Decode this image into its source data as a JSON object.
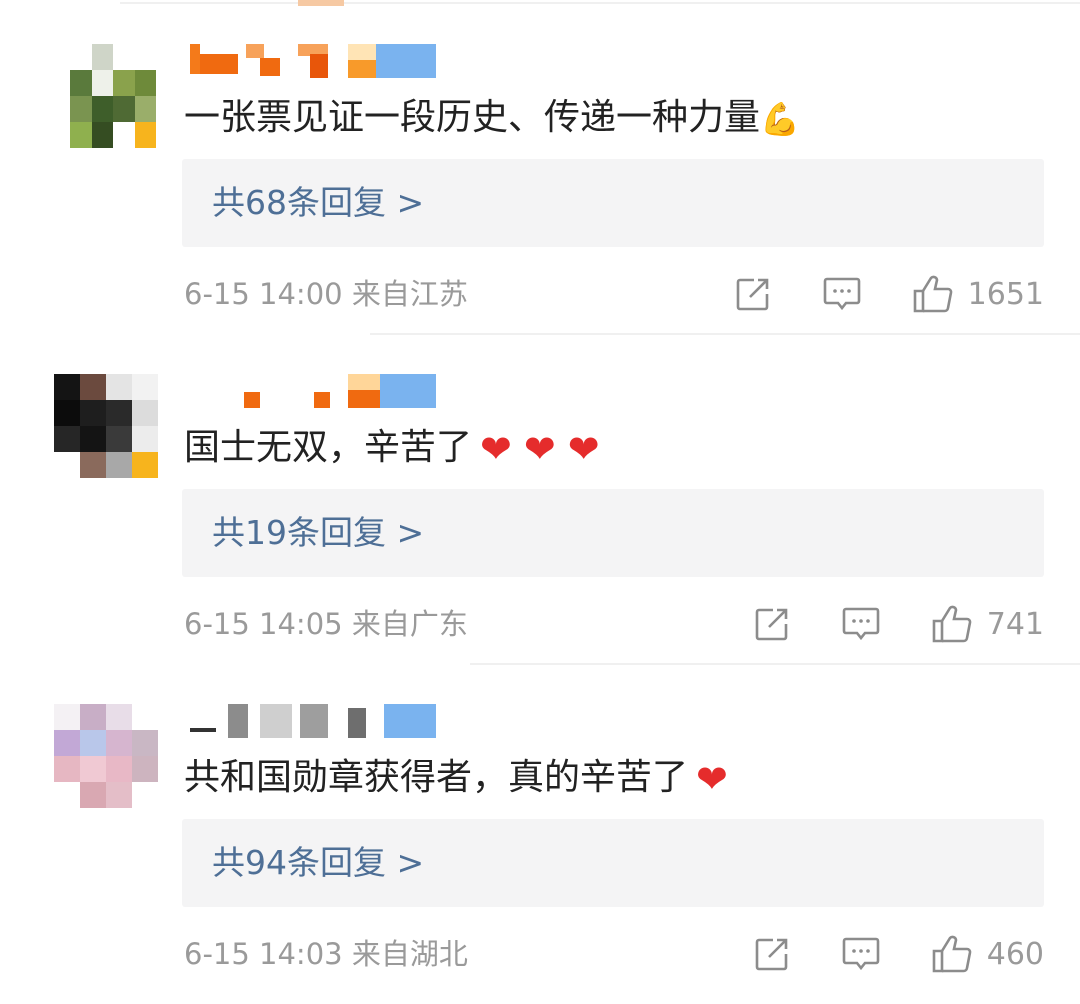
{
  "comments": [
    {
      "text": "一张票见证一段历史、传递一种力量",
      "emojis": [
        "💪"
      ],
      "reply_link": "共68条回复 >",
      "meta": "6-15 14:00 来自江苏",
      "likes": "1651"
    },
    {
      "text": "国士无双，辛苦了",
      "emojis": [
        "❤",
        "❤",
        "❤"
      ],
      "reply_link": "共19条回复 >",
      "meta": "6-15 14:05 来自广东",
      "likes": "741"
    },
    {
      "text": "共和国勋章获得者，真的辛苦了",
      "emojis": [
        "❤"
      ],
      "reply_link": "共94条回复 >",
      "meta": "6-15 14:03 来自湖北",
      "likes": "460"
    }
  ],
  "icons": {
    "share": "share-icon",
    "comment": "comment-icon",
    "like": "thumbs-up-icon",
    "heart": "red-heart-emoji",
    "muscle": "flexed-biceps-emoji"
  },
  "colors": {
    "reply_link": "#4e6f96",
    "meta_text": "#9a9a9a",
    "reply_box_bg": "#f4f4f5",
    "heart": "#e52c2c"
  }
}
